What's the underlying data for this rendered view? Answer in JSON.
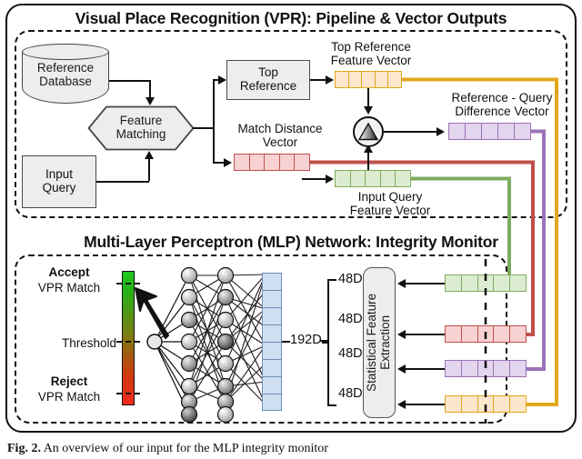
{
  "figure": {
    "caption_bold": "Fig. 2.",
    "caption_text": "An overview of our input for the MLP integrity monitor"
  },
  "top_section": {
    "title": "Visual Place Recognition (VPR): Pipeline & Vector Outputs",
    "nodes": {
      "reference_database": "Reference\nDatabase",
      "reference_database_line1": "Reference",
      "reference_database_line2": "Database",
      "feature_matching_line1": "Feature",
      "feature_matching_line2": "Matching",
      "input_query_line1": "Input",
      "input_query_line2": "Query",
      "top_reference_line1": "Top",
      "top_reference_line2": "Reference",
      "difference_operator": "delta-icon"
    },
    "vectors": [
      {
        "name": "top-reference-feature-vector",
        "label_line1": "Top Reference",
        "label_line2": "Feature Vector",
        "cells": 5,
        "fill": "#fce6cc",
        "stroke": "#e0a81e"
      },
      {
        "name": "match-distance-vector",
        "label_line1": "Match Distance",
        "label_line2": "Vector",
        "cells": 5,
        "fill": "#f8d2d2",
        "stroke": "#bf4f4c"
      },
      {
        "name": "input-query-feature-vector",
        "label_line1": "Input Query",
        "label_line2": "Feature Vector",
        "cells": 5,
        "fill": "#dcecd0",
        "stroke": "#7fab5e"
      },
      {
        "name": "reference-query-difference-vector",
        "label_line1": "Reference - Query",
        "label_line2": "Difference Vector",
        "cells": 5,
        "fill": "#e3d5ed",
        "stroke": "#9b72b8"
      }
    ]
  },
  "bottom_section": {
    "title": "Multi-Layer Perceptron (MLP) Network: Integrity Monitor",
    "colorbar": {
      "top_label_bold": "Accept",
      "top_label_sub": "VPR Match",
      "mid_label": "Threshold",
      "bottom_label_bold": "Reject",
      "bottom_label_sub": "VPR Match",
      "top_color": "#1ec81e",
      "mid_color": "#7d7d12",
      "bottom_color": "#f22a1c"
    },
    "mlp": {
      "output_node_name": "output-neuron",
      "hidden_layer_1_nodes": 8,
      "hidden_layer_2_nodes": 8,
      "input_block_label": "192D",
      "input_block_cells": 8
    },
    "stat_feature_box": {
      "line1": "Statistical Feature",
      "line2": "Extraction",
      "branch_labels": [
        "48D",
        "48D",
        "48D",
        "48D"
      ]
    },
    "input_vectors": [
      {
        "name": "green-stat-input",
        "fill": "#dcecd0",
        "stroke": "#7fab5e",
        "cells": 5
      },
      {
        "name": "red-stat-input",
        "fill": "#f8d2d2",
        "stroke": "#bf4f4c",
        "cells": 5
      },
      {
        "name": "purple-stat-input",
        "fill": "#e3d5ed",
        "stroke": "#9b72b8",
        "cells": 5
      },
      {
        "name": "orange-stat-input",
        "fill": "#fce6cc",
        "stroke": "#e0a81e",
        "cells": 5
      }
    ]
  },
  "routing_colors": {
    "orange": "#e0a81e",
    "red": "#bf4f4c",
    "purple": "#9b72b8",
    "green": "#7fab5e"
  }
}
